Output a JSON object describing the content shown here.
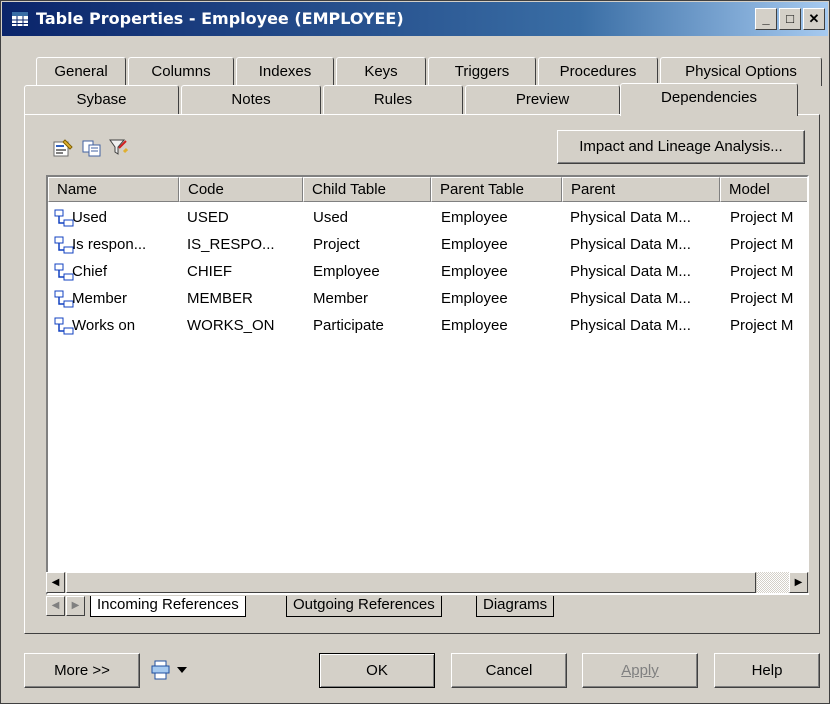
{
  "window": {
    "title": "Table Properties - Employee (EMPLOYEE)",
    "controls": [
      "_",
      "□",
      "✕"
    ]
  },
  "tabs_row1": [
    "General",
    "Columns",
    "Indexes",
    "Keys",
    "Triggers",
    "Procedures",
    "Physical Options"
  ],
  "tabs_row2": [
    "Sybase",
    "Notes",
    "Rules",
    "Preview",
    "Dependencies"
  ],
  "active_tab": "Dependencies",
  "toolbar": {
    "icons": [
      "properties-icon",
      "copy-icon",
      "filter-icon"
    ],
    "impact_button": "Impact and Lineage Analysis..."
  },
  "table": {
    "columns": [
      "Name",
      "Code",
      "Child Table",
      "Parent Table",
      "Parent",
      "Model"
    ],
    "rows": [
      [
        "Used",
        "USED",
        "Used",
        "Employee",
        "Physical Data M...",
        "Project M"
      ],
      [
        "Is respon...",
        "IS_RESPO...",
        "Project",
        "Employee",
        "Physical Data M...",
        "Project M"
      ],
      [
        "Chief",
        "CHIEF",
        "Employee",
        "Employee",
        "Physical Data M...",
        "Project M"
      ],
      [
        "Member",
        "MEMBER",
        "Member",
        "Employee",
        "Physical Data M...",
        "Project M"
      ],
      [
        "Works on",
        "WORKS_ON",
        "Participate",
        "Employee",
        "Physical Data M...",
        "Project M"
      ]
    ]
  },
  "subtabs": [
    "Incoming References",
    "Outgoing References",
    "Diagrams"
  ],
  "active_subtab": "Incoming References",
  "footer": {
    "more": "More >>",
    "ok": "OK",
    "cancel": "Cancel",
    "apply": "Apply",
    "help": "Help"
  },
  "colors": {
    "face": "#d4d0c8",
    "titlebar_start": "#0a246a",
    "titlebar_end": "#a6caf0",
    "disabled_text": "#808080"
  }
}
